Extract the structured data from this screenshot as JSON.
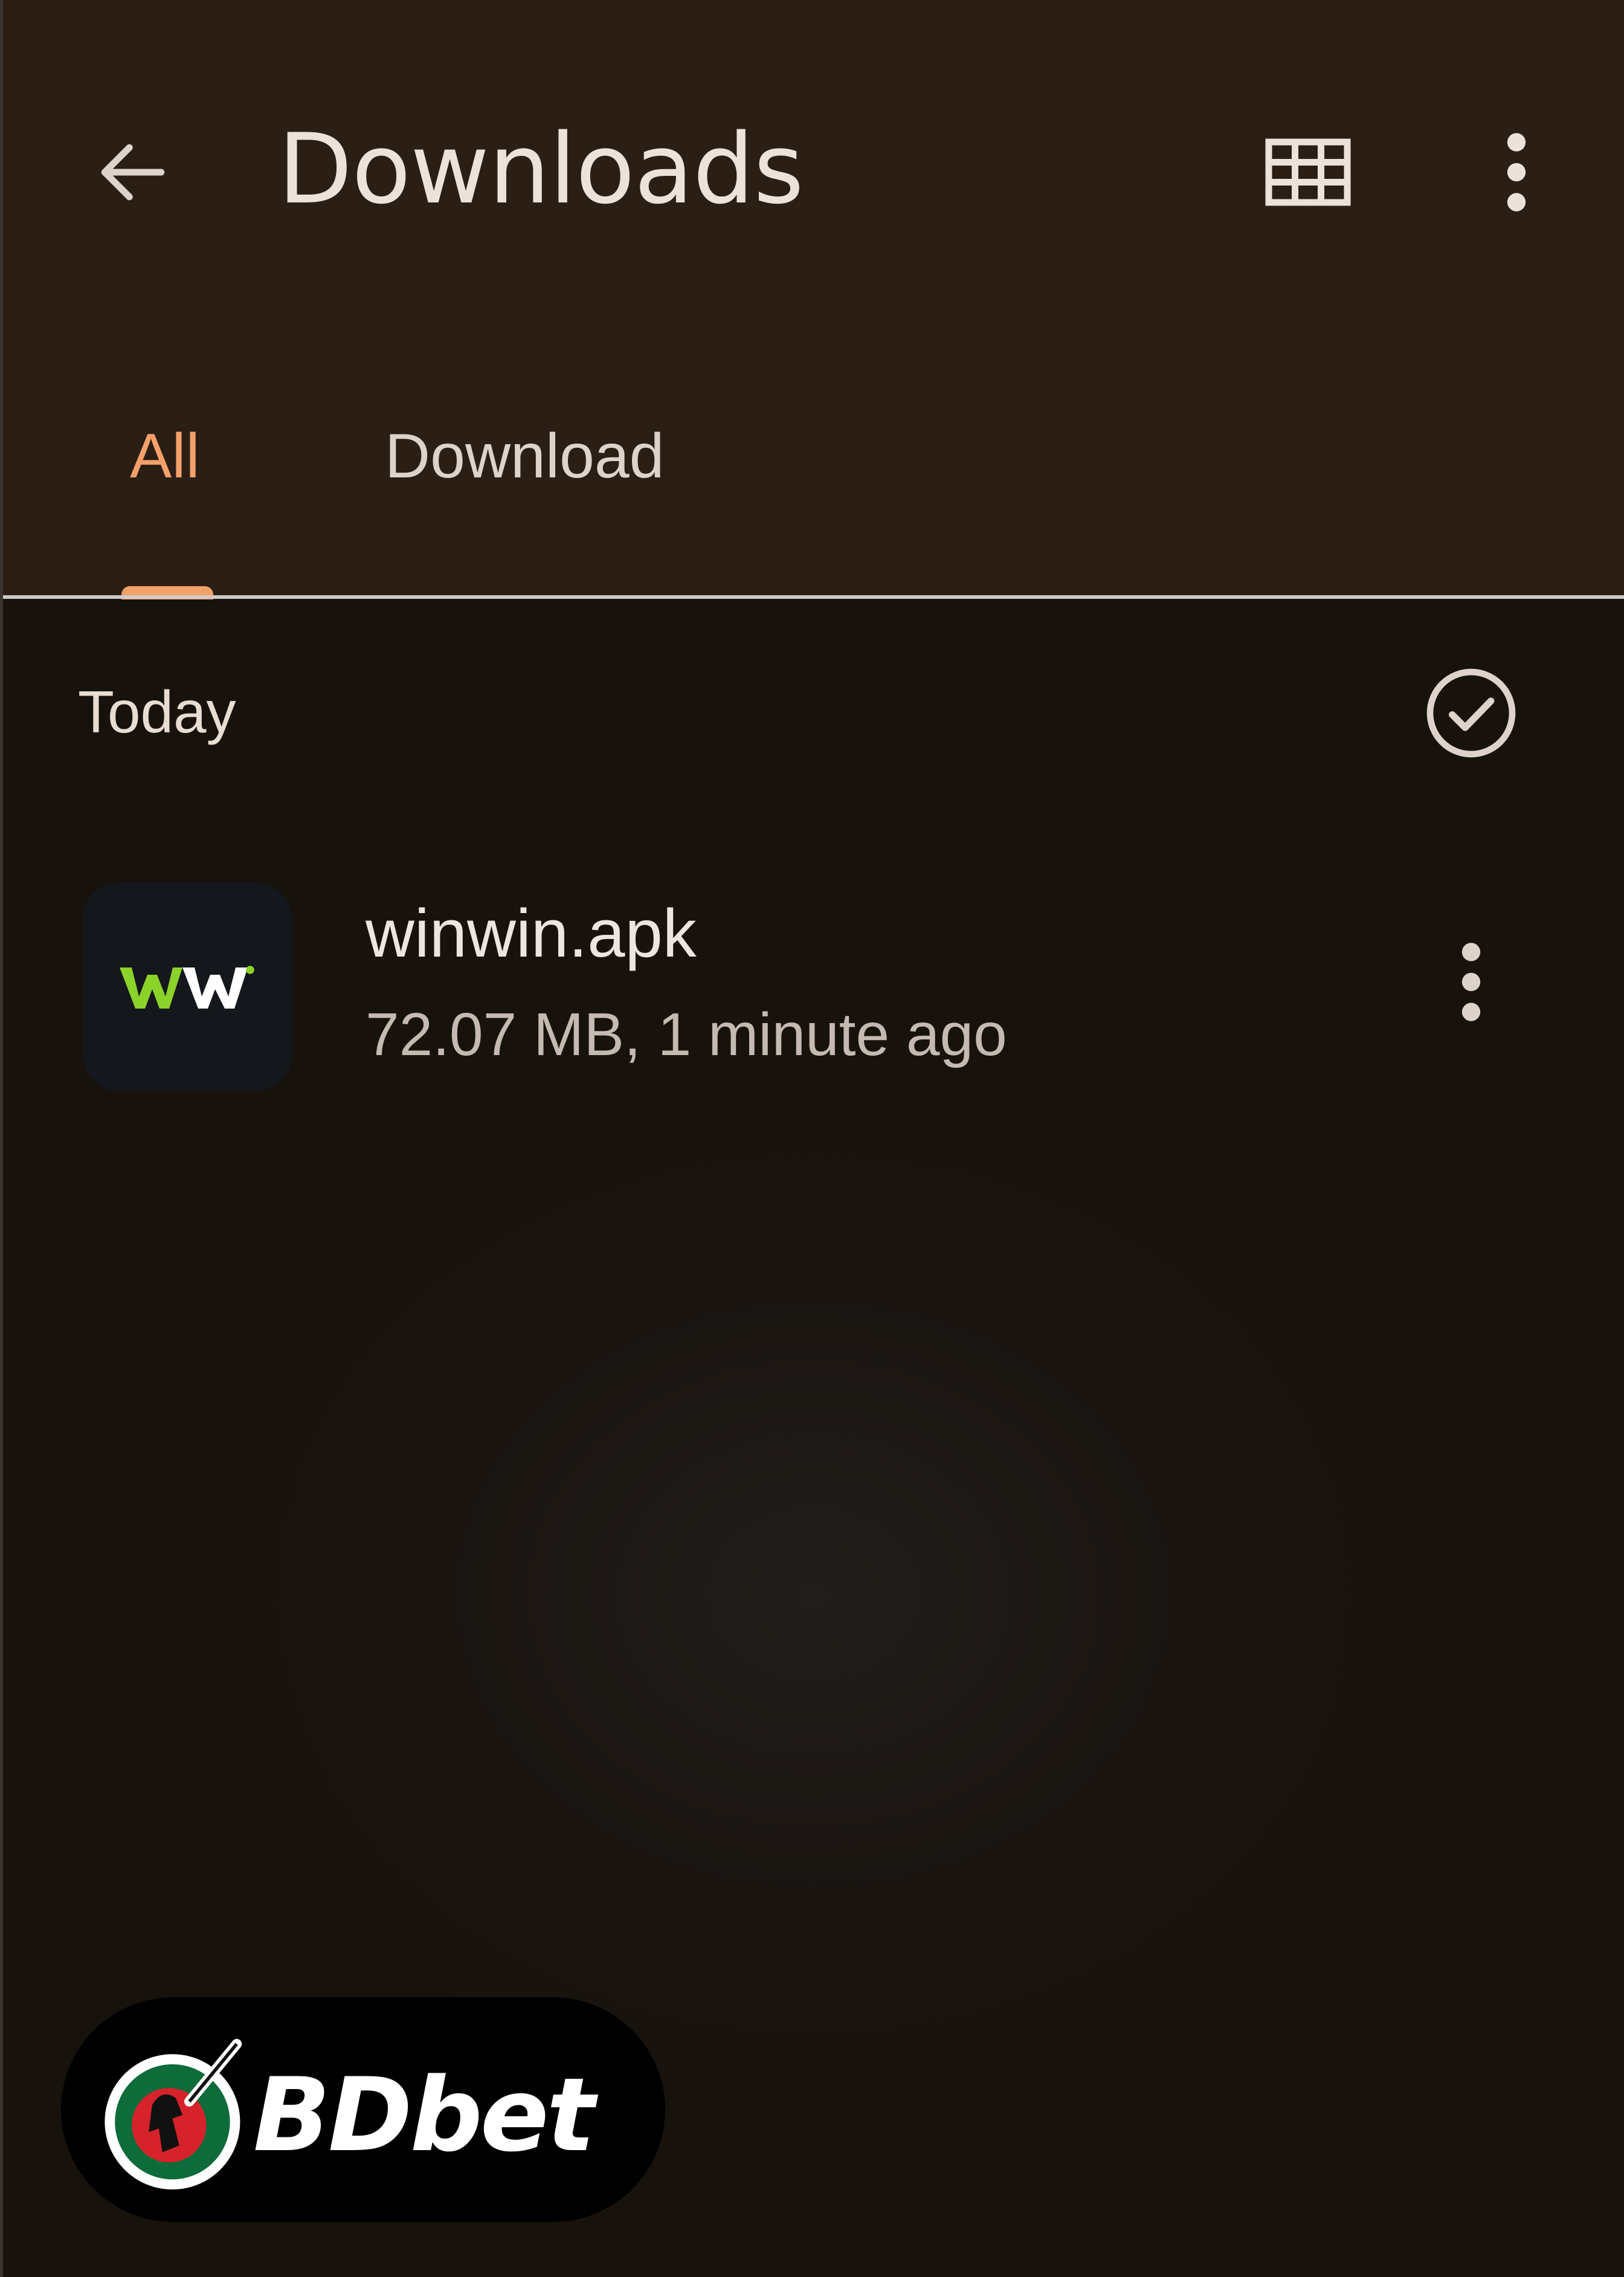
{
  "header": {
    "title": "Downloads",
    "icons": {
      "back": "arrow-left-icon",
      "view": "grid-view-icon",
      "more": "more-vertical-icon"
    }
  },
  "tabs": [
    {
      "label": "All",
      "selected": true
    },
    {
      "label": "Download",
      "selected": false
    }
  ],
  "section": {
    "label": "Today",
    "select_icon": "check-circle-icon"
  },
  "files": [
    {
      "name": "winwin.apk",
      "meta": "72.07 MB, 1 minute ago",
      "icon_text": "WW",
      "icon": "winwin-app-icon"
    }
  ],
  "watermark": {
    "text": "BDbet",
    "icon": "bdbet-logo-icon"
  },
  "colors": {
    "header_bg": "#2b1f15",
    "body_bg": "#19130f",
    "accent": "#f3a06a",
    "text_primary": "#ece2d9",
    "text_secondary": "#c4bab1",
    "brand_green": "#8bd22a"
  }
}
